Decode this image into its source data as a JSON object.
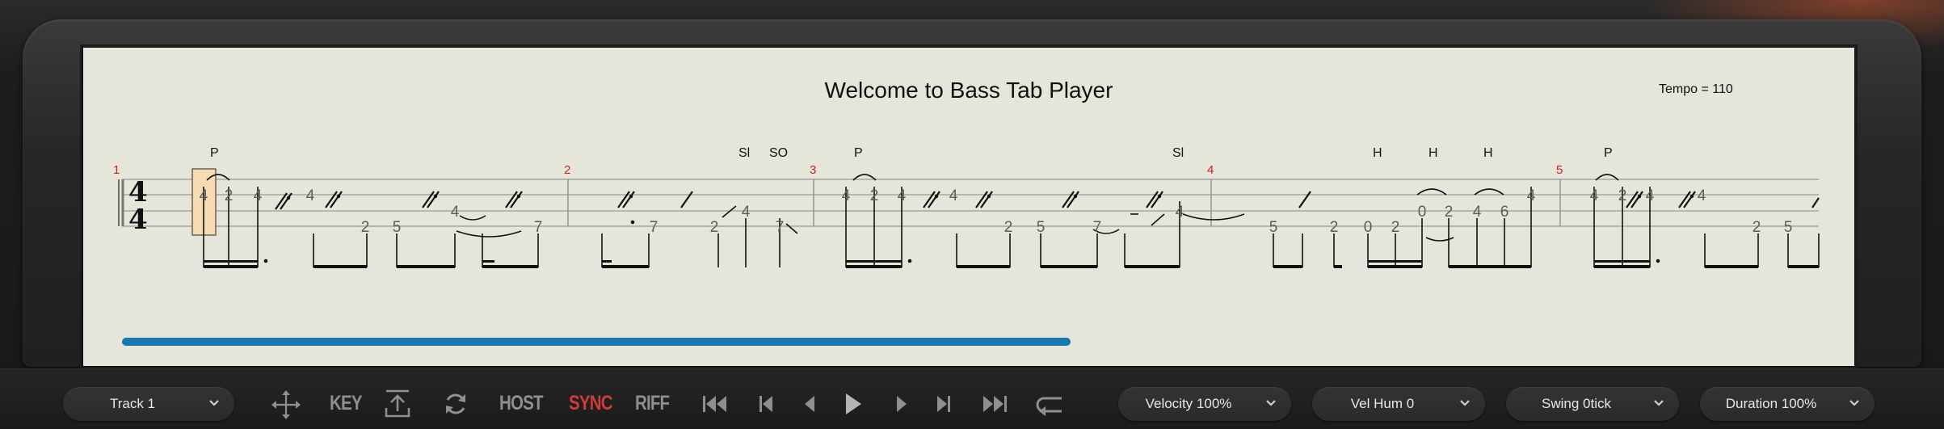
{
  "score": {
    "title": "Welcome to Bass Tab Player",
    "tempo_label": "Tempo = 110",
    "time_signature": {
      "top": "4",
      "bottom": "4"
    },
    "measure_numbers": [
      "1",
      "2",
      "3",
      "4",
      "5"
    ],
    "technique_marks": [
      "P",
      "Sl",
      "SO",
      "P",
      "Sl",
      "H",
      "H",
      "H",
      "P"
    ],
    "fret_numbers": [
      "4",
      "2",
      "4",
      "4",
      "2",
      "5",
      "4",
      "7",
      "7",
      "2",
      "4",
      "7",
      "4",
      "2",
      "4",
      "4",
      "2",
      "5",
      "7",
      "4",
      "5",
      "2",
      "0",
      "2",
      "0",
      "2",
      "4",
      "6",
      "4",
      "4",
      "2",
      "4",
      "4",
      "2",
      "5"
    ],
    "playback_progress": 0.56
  },
  "toolbar": {
    "track_select": "Track 1",
    "key_label": "KEY",
    "host_label": "HOST",
    "sync_label": "SYNC",
    "riff_label": "RIFF",
    "velocity_select": "Velocity 100%",
    "vel_hum_select": "Vel Hum 0",
    "swing_select": "Swing 0tick",
    "duration_select": "Duration 100%",
    "sync_color": "#d23a3a",
    "label_color": "#8f8f8f"
  },
  "icons": {
    "move": "move-icon",
    "export": "export-icon",
    "loop": "loop-icon",
    "rewind": "rewind-start-icon",
    "prev": "previous-icon",
    "back": "step-back-icon",
    "play": "play-icon",
    "forward": "step-forward-icon",
    "next": "next-icon",
    "fast_forward": "fast-forward-icon",
    "return": "return-icon",
    "chevron": "chevron-down-icon"
  }
}
